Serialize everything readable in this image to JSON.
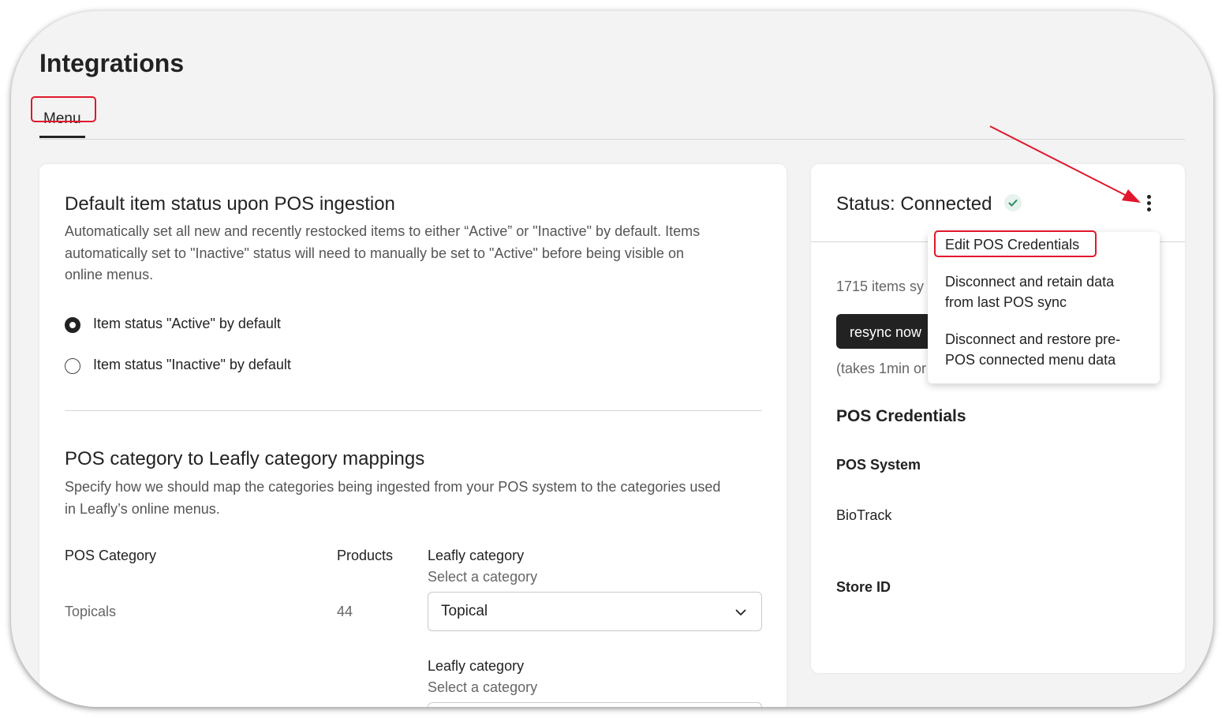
{
  "page": {
    "title": "Integrations"
  },
  "tabs": [
    {
      "label": "Menu"
    }
  ],
  "default_status": {
    "heading": "Default item status upon POS ingestion",
    "desc_line1": "Automatically set all new and recently restocked items to either “Active” or \"Inactive\" by default. Items",
    "desc_line2": "automatically set to \"Inactive\" status will need to manually be set to \"Active\" before being visible on",
    "desc_line3": "online menus.",
    "options": [
      {
        "label": "Item status \"Active\" by default",
        "selected": true
      },
      {
        "label": "Item status \"Inactive\" by default",
        "selected": false
      }
    ]
  },
  "mappings": {
    "heading": "POS category to Leafly category mappings",
    "desc_line1": "Specify how we should map the categories being ingested from your POS system to the categories used",
    "desc_line2": "in Leafly’s online menus.",
    "col_pos": "POS Category",
    "col_products": "Products",
    "col_leafly": "Leafly category",
    "select_hint": "Select a category",
    "rows": [
      {
        "pos_category": "Topicals",
        "products": "44",
        "leafly_category": "Topical"
      },
      {
        "pos_category": "",
        "products": "",
        "leafly_category": ""
      }
    ]
  },
  "status_card": {
    "title": "Status: Connected",
    "sync_text": "1715 items sy",
    "resync_label": "resync now",
    "takes_text": "(takes 1min or",
    "credentials_heading": "POS Credentials",
    "pos_system_label": "POS System",
    "pos_system_value": "BioTrack",
    "store_id_label": "Store ID"
  },
  "dropdown_menu": {
    "items": [
      {
        "line1": "Edit POS Credentials",
        "line2": ""
      },
      {
        "line1": "Disconnect and retain data",
        "line2": "from last POS sync"
      },
      {
        "line1": "Disconnect and restore pre-",
        "line2": "POS connected menu data"
      }
    ]
  },
  "colors": {
    "annotation": "#e0182d",
    "check": "#2d8a63",
    "dark_button": "#222222"
  },
  "icons": {
    "status_check": "check-circle-icon",
    "kebab": "more-vertical-icon",
    "select_chevron": "chevron-down-icon"
  }
}
